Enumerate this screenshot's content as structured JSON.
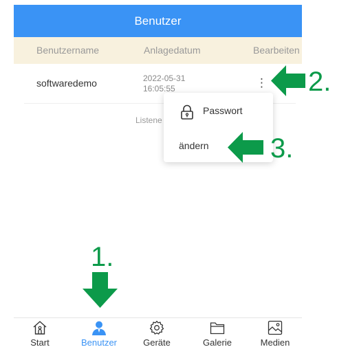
{
  "header": {
    "title": "Benutzer"
  },
  "table": {
    "columns": [
      "Benutzername",
      "Anlagedatum",
      "Bearbeiten"
    ],
    "rows": [
      {
        "username": "softwaredemo",
        "date": "2022-05-31",
        "time": "16:05:55"
      }
    ]
  },
  "hint_text": "Listene",
  "menu": {
    "item1": "Passwort",
    "item2": "ändern"
  },
  "tabs": [
    {
      "label": "Start",
      "icon": "home-icon"
    },
    {
      "label": "Benutzer",
      "icon": "user-icon",
      "active": true
    },
    {
      "label": "Geräte",
      "icon": "gear-icon"
    },
    {
      "label": "Galerie",
      "icon": "folder-icon"
    },
    {
      "label": "Medien",
      "icon": "image-icon"
    }
  ],
  "annotations": {
    "step1": "1.",
    "step2": "2.",
    "step3": "3."
  },
  "colors": {
    "accent": "#3a93f5",
    "header_row": "#f8f1de",
    "annotation": "#0c9a4a"
  }
}
